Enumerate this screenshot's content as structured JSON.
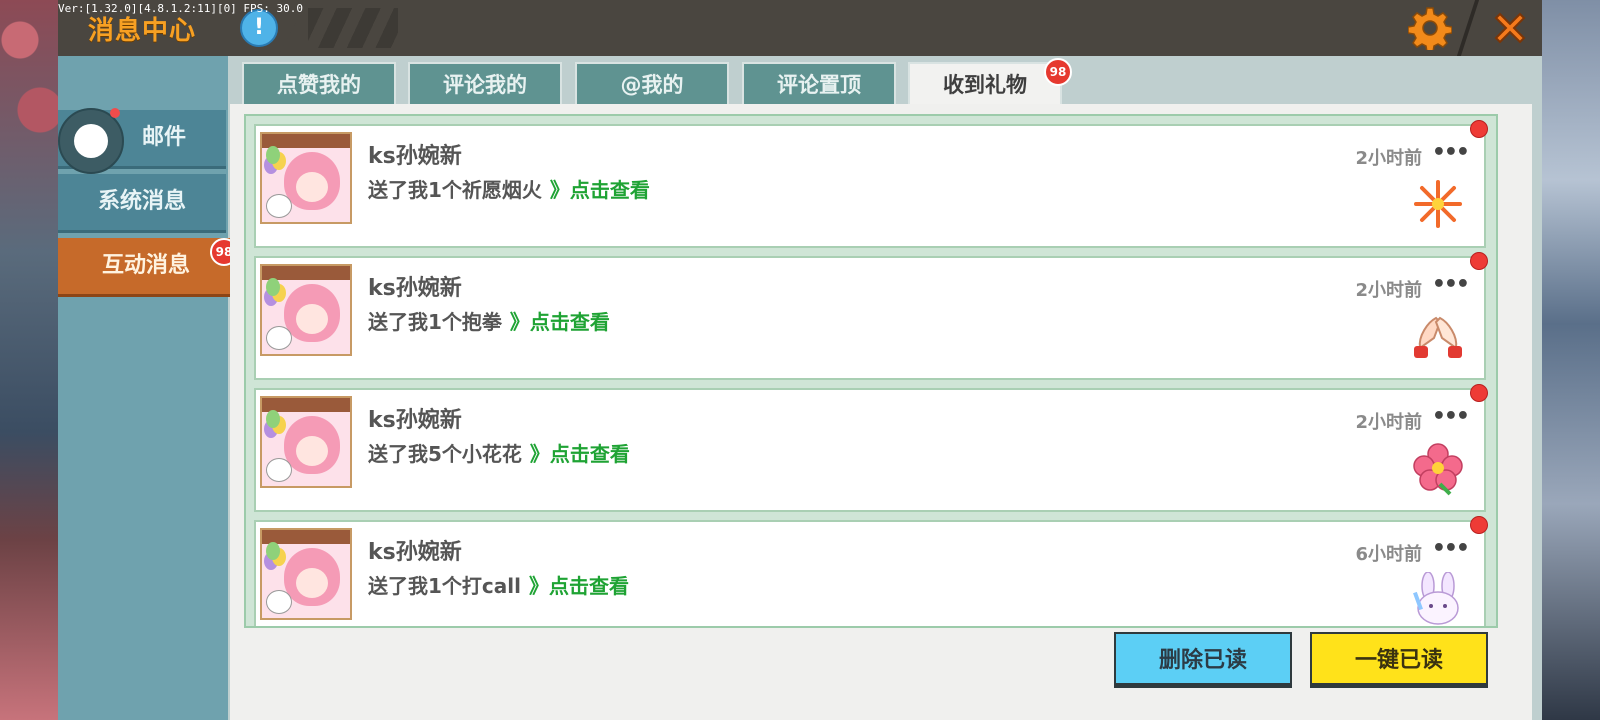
{
  "debug": {
    "version_text": "Ver:[1.32.0][4.8.1.2:11][0] FPS: 30.0"
  },
  "header": {
    "title": "消息中心",
    "info_icon": "!",
    "settings_icon": "gear-icon",
    "close_icon": "close-icon",
    "accent_color": "#f7a023"
  },
  "sidebar": {
    "items": [
      {
        "label": "邮件",
        "has_dot": true
      },
      {
        "label": "系统消息"
      },
      {
        "label": "互动消息",
        "active": true,
        "badge": "98"
      }
    ]
  },
  "tabs": [
    {
      "label": "点赞我的"
    },
    {
      "label": "评论我的"
    },
    {
      "label": "@我的"
    },
    {
      "label": "评论置顶"
    },
    {
      "label": "收到礼物",
      "active": true,
      "badge": "98"
    }
  ],
  "messages": [
    {
      "name": "ks孙婉新",
      "text": "送了我1个祈愿烟火",
      "link": "》点击查看",
      "time": "2小时前",
      "gift_icon": "firework-icon",
      "unread": true
    },
    {
      "name": "ks孙婉新",
      "text": "送了我1个抱拳",
      "link": "》点击查看",
      "time": "2小时前",
      "gift_icon": "fist-salute-icon",
      "unread": true
    },
    {
      "name": "ks孙婉新",
      "text": "送了我5个小花花",
      "link": "》点击查看",
      "time": "2小时前",
      "gift_icon": "flower-icon",
      "unread": true
    },
    {
      "name": "ks孙婉新",
      "text": "送了我1个打call",
      "link": "》点击查看",
      "time": "6小时前",
      "gift_icon": "bunny-call-icon",
      "unread": true
    }
  ],
  "footer": {
    "delete_read_label": "删除已读",
    "mark_all_read_label": "一键已读"
  },
  "colors": {
    "link_green": "#1fa334",
    "active_side": "#c66a2a",
    "delete_btn": "#5ccff5",
    "readall_btn": "#ffe21a",
    "unread_dot": "#ee3b36"
  }
}
